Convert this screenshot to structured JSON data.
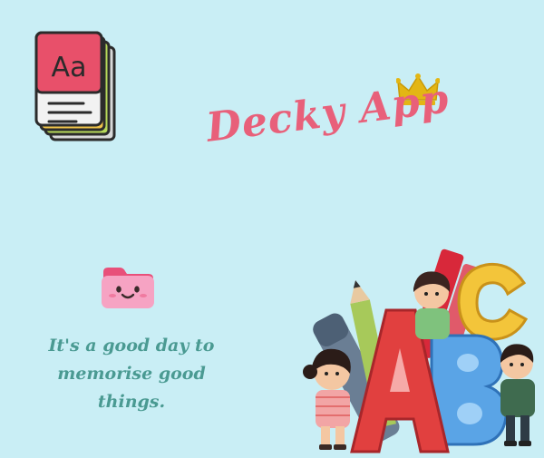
{
  "header": {
    "title": "Decky App",
    "book_icon_text": "Aa"
  },
  "tagline": "It's a good day to memorise good things.",
  "colors": {
    "background": "#c9eef5",
    "title": "#e8607a",
    "tagline": "#4a9a92",
    "crown": "#e3b614"
  },
  "icons": [
    "book-stack-icon",
    "crown-icon",
    "folder-face-icon",
    "abc-kids-illustration"
  ]
}
